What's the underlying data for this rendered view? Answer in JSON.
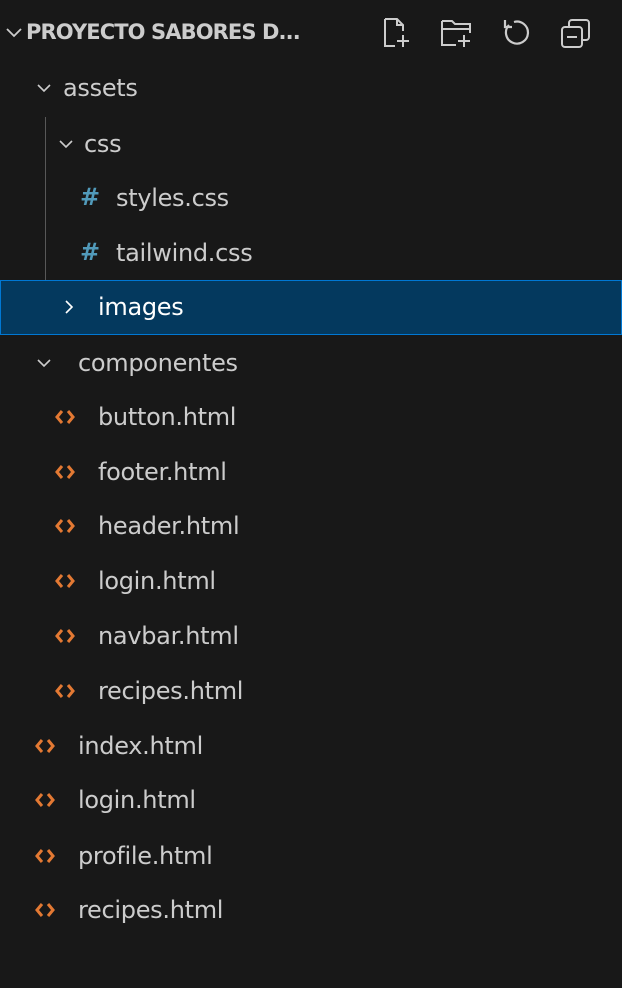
{
  "explorer": {
    "title": "PROYECTO SABORES D...",
    "actions": [
      {
        "name": "new-file-icon"
      },
      {
        "name": "new-folder-icon"
      },
      {
        "name": "refresh-icon"
      },
      {
        "name": "collapse-all-icon"
      }
    ]
  },
  "tree": {
    "assets": "assets",
    "css": "css",
    "styles_css": "styles.css",
    "tailwind_css": "tailwind.css",
    "images": "images",
    "componentes": "componentes",
    "button_html": "button.html",
    "footer_html": "footer.html",
    "header_html": "header.html",
    "comp_login_html": "login.html",
    "navbar_html": "navbar.html",
    "comp_recipes_html": "recipes.html",
    "index_html": "index.html",
    "login_html": "login.html",
    "profile_html": "profile.html",
    "recipes_html": "recipes.html"
  },
  "icons": {
    "css_file_glyph": "#",
    "html_file_icon": "html-file-icon"
  },
  "colors": {
    "background": "#181818",
    "text": "#cccccc",
    "selected_background": "#04395e",
    "selected_border": "#0078d4",
    "css_icon": "#519aba",
    "html_icon": "#e37933",
    "indent_guide": "#585858"
  }
}
